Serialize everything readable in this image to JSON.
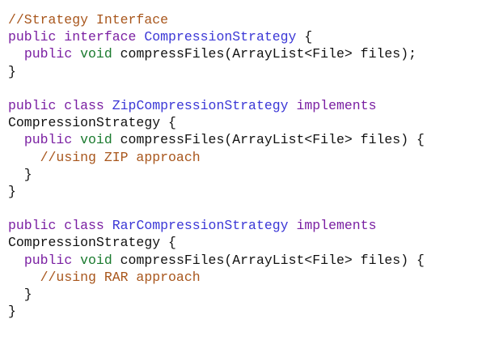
{
  "editor": {
    "colors": {
      "plain": "#111111",
      "keyword": "#7a1fa2",
      "type": "#1a7a2e",
      "class": "#3b37d6",
      "comment": "#a8561c",
      "background": "#ffffff"
    },
    "lines": [
      [
        {
          "t": "comment",
          "v": "//Strategy Interface"
        }
      ],
      [
        {
          "t": "keyword",
          "v": "public interface "
        },
        {
          "t": "class",
          "v": "CompressionStrategy"
        },
        {
          "t": "plain",
          "v": " {"
        }
      ],
      [
        {
          "t": "plain",
          "v": "  "
        },
        {
          "t": "keyword",
          "v": "public "
        },
        {
          "t": "type",
          "v": "void"
        },
        {
          "t": "plain",
          "v": " compressFiles(ArrayList<File> files);"
        }
      ],
      [
        {
          "t": "plain",
          "v": "}"
        }
      ],
      [],
      [
        {
          "t": "keyword",
          "v": "public class "
        },
        {
          "t": "class",
          "v": "ZipCompressionStrategy"
        },
        {
          "t": "keyword",
          "v": " implements"
        }
      ],
      [
        {
          "t": "plain",
          "v": "CompressionStrategy {"
        }
      ],
      [
        {
          "t": "plain",
          "v": "  "
        },
        {
          "t": "keyword",
          "v": "public "
        },
        {
          "t": "type",
          "v": "void"
        },
        {
          "t": "plain",
          "v": " compressFiles(ArrayList<File> files) {"
        }
      ],
      [
        {
          "t": "plain",
          "v": "    "
        },
        {
          "t": "comment",
          "v": "//using ZIP approach"
        }
      ],
      [
        {
          "t": "plain",
          "v": "  }"
        }
      ],
      [
        {
          "t": "plain",
          "v": "}"
        }
      ],
      [],
      [
        {
          "t": "keyword",
          "v": "public class "
        },
        {
          "t": "class",
          "v": "RarCompressionStrategy"
        },
        {
          "t": "keyword",
          "v": " implements"
        }
      ],
      [
        {
          "t": "plain",
          "v": "CompressionStrategy {"
        }
      ],
      [
        {
          "t": "plain",
          "v": "  "
        },
        {
          "t": "keyword",
          "v": "public "
        },
        {
          "t": "type",
          "v": "void"
        },
        {
          "t": "plain",
          "v": " compressFiles(ArrayList<File> files) {"
        }
      ],
      [
        {
          "t": "plain",
          "v": "    "
        },
        {
          "t": "comment",
          "v": "//using RAR approach"
        }
      ],
      [
        {
          "t": "plain",
          "v": "  }"
        }
      ],
      [
        {
          "t": "plain",
          "v": "}"
        }
      ]
    ]
  }
}
